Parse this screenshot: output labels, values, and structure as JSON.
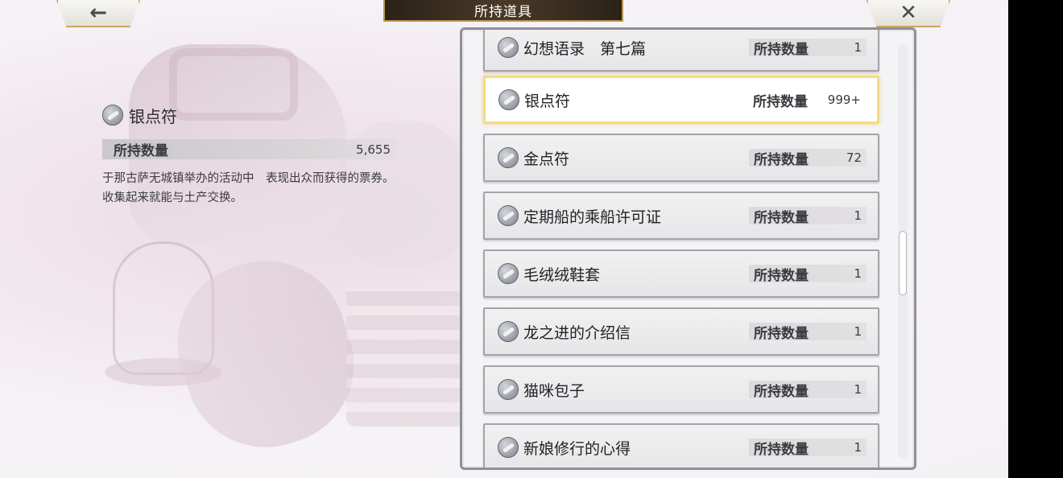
{
  "header": {
    "title": "所持道具",
    "back_icon": "←",
    "close_icon": "✕"
  },
  "detail": {
    "name": "银点符",
    "qty_label": "所持数量",
    "qty_value": "5,655",
    "description": "于那古萨无城镇举办的活动中　表现出众而获得的票券。收集起来就能与土产交换。"
  },
  "list": {
    "qty_label": "所持数量",
    "items": [
      {
        "name": "幻想语录　第七篇",
        "qty": "1"
      },
      {
        "name": "银点符",
        "qty": "999+",
        "selected": true
      },
      {
        "name": "金点符",
        "qty": "72"
      },
      {
        "name": "定期船的乘船许可证",
        "qty": "1"
      },
      {
        "name": "毛绒绒鞋套",
        "qty": "1"
      },
      {
        "name": "龙之进的介绍信",
        "qty": "1"
      },
      {
        "name": "猫咪包子",
        "qty": "1"
      },
      {
        "name": "新娘修行的心得",
        "qty": "1"
      }
    ]
  },
  "colors": {
    "selected_border": "#f1db85",
    "title_bar": "#3a2e20",
    "gold_trim": "#c9a85d"
  },
  "icons": {
    "item": "ticket-coin-icon"
  }
}
